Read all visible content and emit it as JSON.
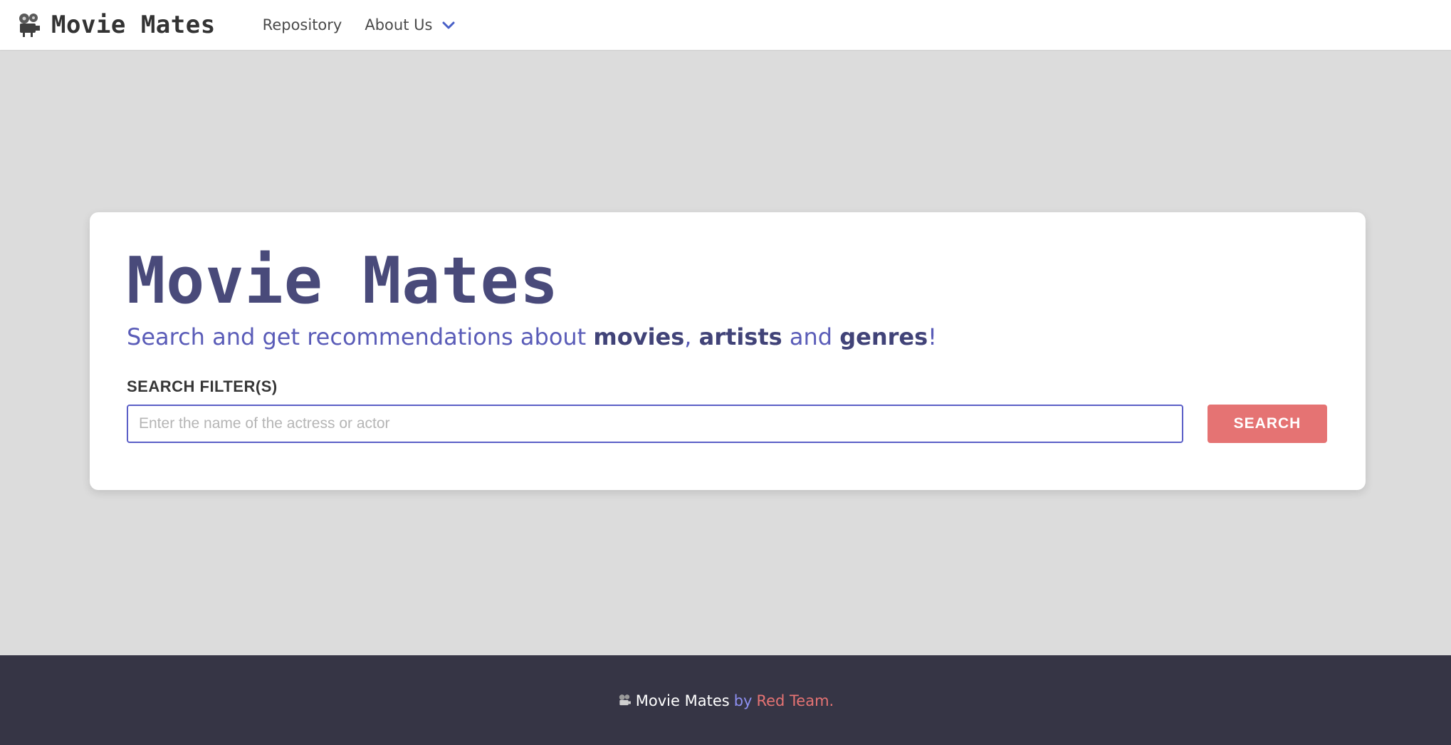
{
  "navbar": {
    "brand_icon": "film-projector-icon",
    "brand_text": "Movie Mates",
    "links": {
      "repository": "Repository",
      "about": "About Us"
    },
    "dropdown_icon": "chevron-down-icon"
  },
  "hero": {
    "title": "Movie Mates",
    "subtitle_prefix": "Search and get recommendations about ",
    "subtitle_movies": "movies",
    "subtitle_comma": ", ",
    "subtitle_artists": "artists",
    "subtitle_and": " and ",
    "subtitle_genres": "genres",
    "subtitle_end": "!"
  },
  "search": {
    "label": "SEARCH FILTER(S)",
    "placeholder": "Enter the name of the actress or actor",
    "value": "",
    "button_label": "SEARCH"
  },
  "footer": {
    "icon": "film-projector-icon",
    "brand": "Movie Mates",
    "by": "by",
    "team": "Red Team."
  },
  "colors": {
    "background": "#dcdcdc",
    "title": "#494a7a",
    "subtitle": "#5a5cb8",
    "accent": "#5b5fc7",
    "button": "#e57373",
    "footer_bg": "#363545"
  }
}
